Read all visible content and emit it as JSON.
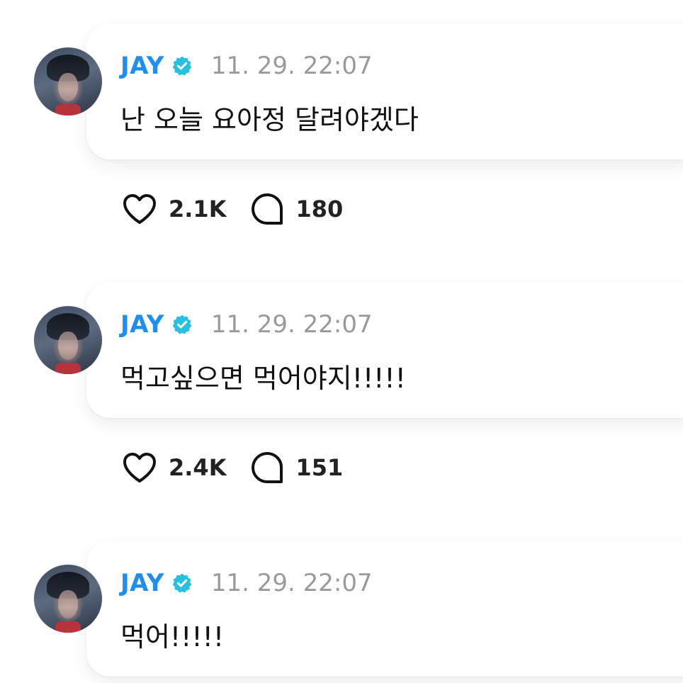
{
  "posts": [
    {
      "author": "JAY",
      "timestamp": "11. 29. 22:07",
      "text": "난 오늘 요아정 달려야겠다",
      "likes": "2.1K",
      "comments": "180"
    },
    {
      "author": "JAY",
      "timestamp": "11. 29. 22:07",
      "text": "먹고싶으면 먹어야지!!!!!",
      "likes": "2.4K",
      "comments": "151"
    },
    {
      "author": "JAY",
      "timestamp": "11. 29. 22:07",
      "text": "먹어!!!!!"
    }
  ],
  "icons": {
    "verified": "verified-badge-icon",
    "like": "heart-outline-icon",
    "comment": "speech-bubble-outline-icon"
  },
  "colors": {
    "author": "#1f8ef1",
    "verified_badge": "#27c0e0",
    "timestamp": "#9a9a9a",
    "text": "#111111",
    "background": "#ffffff"
  }
}
